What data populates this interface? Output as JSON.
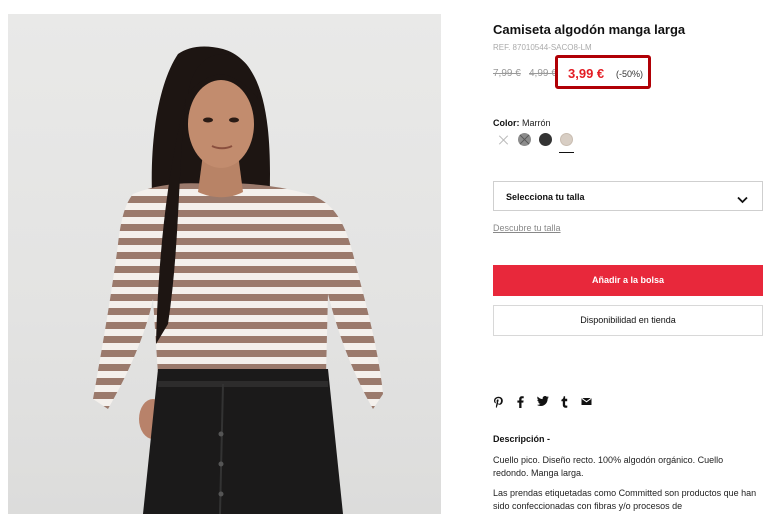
{
  "product": {
    "title": "Camiseta algodón manga larga",
    "ref": "REF. 87010544-SACO8-LM",
    "old_price_1": "7,99 €",
    "old_price_2": "4,99 €",
    "current_price": "3,99 €",
    "discount": "(-50%)",
    "colors": {
      "label": "Color:",
      "selected_name": "Marrón",
      "swatches": [
        "unavailable",
        "#8c8c8c",
        "#333333",
        "#d8cec4"
      ]
    },
    "size_select_label": "Selecciona tu talla",
    "size_guide_link": "Descubre tu talla",
    "add_to_bag_label": "Añadir a la bolsa",
    "store_availability_label": "Disponibilidad en tienda",
    "share": {
      "icons": [
        "pinterest-icon",
        "facebook-icon",
        "twitter-icon",
        "tumblr-icon",
        "email-icon"
      ],
      "glyphs": [
        "℗",
        "f",
        "🐦",
        "t",
        "✉"
      ]
    },
    "description": {
      "title": "Descripción -",
      "paragraph_1": "Cuello pico. Diseño recto. 100% algodón orgánico. Cuello redondo. Manga larga.",
      "paragraph_2": "Las prendas etiquetadas como Committed son productos que han sido confeccionadas con fibras y/o procesos de"
    }
  },
  "colors": {
    "accent_red": "#e8283b",
    "price_red": "#e31b23",
    "highlight_box": "#b00006"
  }
}
